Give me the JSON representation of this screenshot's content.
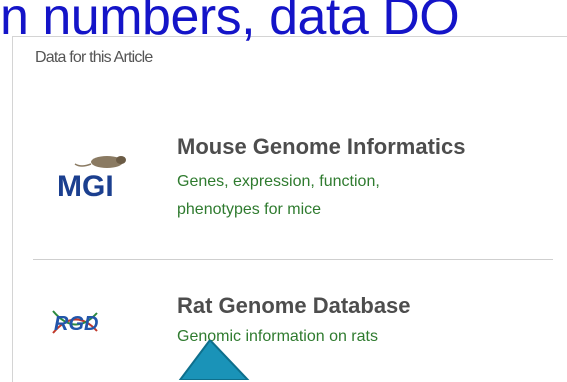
{
  "slide": {
    "overlay_title": "n numbers, data DO"
  },
  "panel": {
    "title": "Data for this Article",
    "items": [
      {
        "logo": "mgi-logo",
        "logo_text": "MGI",
        "name": "Mouse Genome Informatics",
        "description_line1": "Genes, expression, function,",
        "description_line2": "phenotypes for mice"
      },
      {
        "logo": "rgd-logo",
        "logo_text": "RGD",
        "name": "Rat Genome Database",
        "description_line1": "Genomic information on rats"
      }
    ]
  },
  "colors": {
    "overlay_title": "#1414c8",
    "item_name": "#4d4d4d",
    "item_description": "#2f7b2f",
    "mgi_logo": "#1b3f8f",
    "rgd_logo": "#2255aa",
    "arrow": "#1a93b8"
  }
}
